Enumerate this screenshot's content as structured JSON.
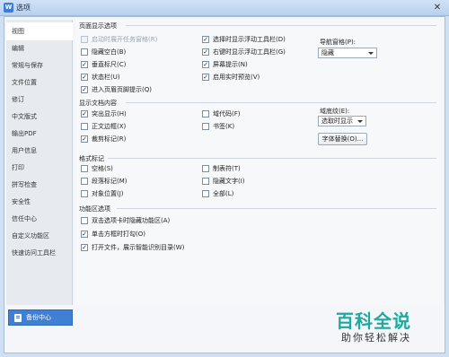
{
  "window": {
    "title": "选项",
    "app_icon_glyph": "W",
    "close_glyph": "✕"
  },
  "sidebar": {
    "items": [
      {
        "label": "视图",
        "active": true
      },
      {
        "label": "编辑"
      },
      {
        "label": "常规与保存"
      },
      {
        "label": "文件位置"
      },
      {
        "label": "修订"
      },
      {
        "label": "中文版式"
      },
      {
        "label": "输出PDF"
      },
      {
        "label": "用户信息"
      },
      {
        "label": "打印"
      },
      {
        "label": "拼写检查"
      },
      {
        "label": "安全性"
      },
      {
        "label": "信任中心"
      },
      {
        "label": "自定义功能区"
      },
      {
        "label": "快速访问工具栏"
      }
    ],
    "backup_button": "备份中心"
  },
  "page_display": {
    "title": "页面显示选项",
    "col1": [
      {
        "label": "启动时展开任务窗格(R)",
        "checked": false,
        "disabled": true
      },
      {
        "label": "隐藏空白(B)",
        "checked": false
      },
      {
        "label": "垂直标尺(C)",
        "checked": true
      },
      {
        "label": "状态栏(U)",
        "checked": true
      },
      {
        "label": "进入页眉页脚提示(Q)",
        "checked": true
      }
    ],
    "col2": [
      {
        "label": "选择时显示浮动工具栏(D)",
        "checked": true
      },
      {
        "label": "右键时显示浮动工具栏(G)",
        "checked": true
      },
      {
        "label": "屏幕提示(N)",
        "checked": true
      },
      {
        "label": "启用实时预览(V)",
        "checked": true
      }
    ],
    "nav_pane_label": "导航窗格(P):",
    "nav_pane_value": "隐藏"
  },
  "doc_content": {
    "title": "显示文档内容",
    "col1": [
      {
        "label": "突出显示(H)",
        "checked": true
      },
      {
        "label": "正文边框(X)",
        "checked": false
      },
      {
        "label": "裁剪标记(R)",
        "checked": true
      }
    ],
    "col2": [
      {
        "label": "域代码(F)",
        "checked": false
      },
      {
        "label": "书签(K)",
        "checked": false
      }
    ],
    "field_shading_label": "域底纹(E):",
    "field_shading_value": "选取时显示",
    "font_sub_button": "字体替换(O)..."
  },
  "format_marks": {
    "title": "格式标记",
    "col1": [
      {
        "label": "空格(S)",
        "checked": false
      },
      {
        "label": "段落标记(M)",
        "checked": false
      },
      {
        "label": "对象位置(J)",
        "checked": false
      }
    ],
    "col2": [
      {
        "label": "制表符(T)",
        "checked": false
      },
      {
        "label": "隐藏文字(I)",
        "checked": false
      },
      {
        "label": "全部(L)",
        "checked": false
      }
    ]
  },
  "ribbon": {
    "title": "功能区选项",
    "items": [
      {
        "label": "双击选项卡时隐藏功能区(A)",
        "checked": false
      },
      {
        "label": "单击方框时打勾(O)",
        "checked": true
      },
      {
        "label": "打开文件，展示智能识别目录(W)",
        "checked": true
      }
    ]
  },
  "watermark": {
    "main": "百科全说",
    "sub": "助你轻松解决"
  },
  "check_glyph": "✓"
}
